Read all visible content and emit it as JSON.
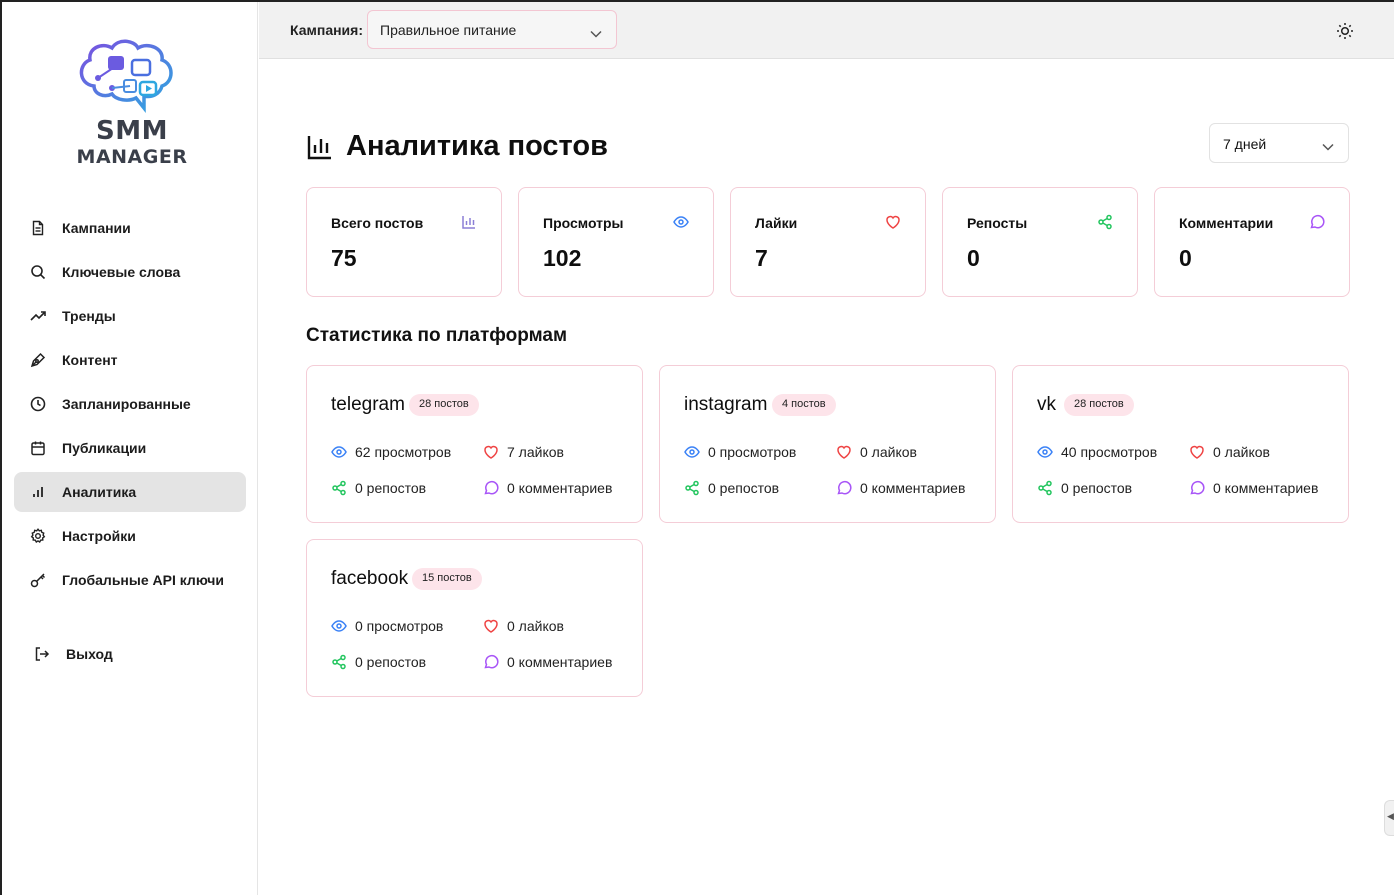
{
  "app": {
    "logo_line1": "SMM",
    "logo_line2": "MANAGER"
  },
  "sidebar": {
    "items": [
      {
        "label": "Кампании",
        "icon": "document-icon"
      },
      {
        "label": "Ключевые слова",
        "icon": "search-icon"
      },
      {
        "label": "Тренды",
        "icon": "trending-up-icon"
      },
      {
        "label": "Контент",
        "icon": "pen-icon"
      },
      {
        "label": "Запланированные",
        "icon": "clock-icon"
      },
      {
        "label": "Публикации",
        "icon": "calendar-icon"
      },
      {
        "label": "Аналитика",
        "icon": "bar-chart-icon",
        "active": true
      },
      {
        "label": "Настройки",
        "icon": "gear-icon"
      },
      {
        "label": "Глобальные API ключи",
        "icon": "key-icon"
      }
    ],
    "exit_label": "Выход"
  },
  "topbar": {
    "campaign_label": "Кампания:",
    "campaign_value": "Правильное питание"
  },
  "main": {
    "title": "Аналитика постов",
    "period": "7 дней",
    "stats": [
      {
        "label": "Всего постов",
        "value": "75",
        "icon": "bar-chart-icon",
        "color": "#8b7fd6"
      },
      {
        "label": "Просмотры",
        "value": "102",
        "icon": "eye-icon",
        "color": "#3b82f6"
      },
      {
        "label": "Лайки",
        "value": "7",
        "icon": "heart-icon",
        "color": "#ef4444"
      },
      {
        "label": "Репосты",
        "value": "0",
        "icon": "share-icon",
        "color": "#22c55e"
      },
      {
        "label": "Комментарии",
        "value": "0",
        "icon": "comment-icon",
        "color": "#a855f7"
      }
    ],
    "section_title": "Статистика по платформам",
    "platforms": [
      {
        "name": "telegram",
        "badge": "28 постов",
        "views": "62 просмотров",
        "likes": "7 лайков",
        "reposts": "0 репостов",
        "comments": "0 комментариев"
      },
      {
        "name": "instagram",
        "badge": "4 постов",
        "views": "0 просмотров",
        "likes": "0 лайков",
        "reposts": "0 репостов",
        "comments": "0 комментариев"
      },
      {
        "name": "vk",
        "badge": "28 постов",
        "views": "40 просмотров",
        "likes": "0 лайков",
        "reposts": "0 репостов",
        "comments": "0 комментариев"
      },
      {
        "name": "facebook",
        "badge": "15 постов",
        "views": "0 просмотров",
        "likes": "0 лайков",
        "reposts": "0 репостов",
        "comments": "0 комментариев"
      }
    ]
  }
}
